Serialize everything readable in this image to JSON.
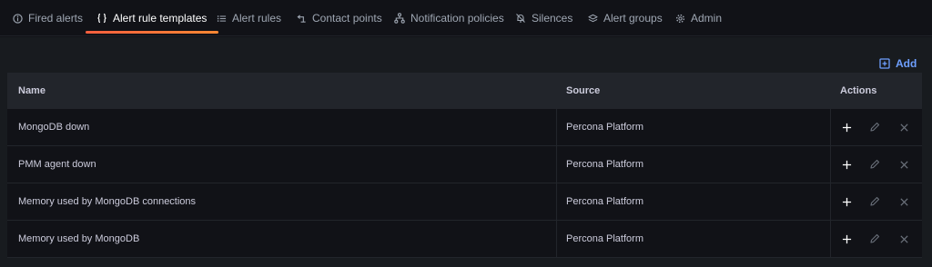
{
  "tabs": [
    {
      "label": "Fired alerts",
      "icon": "info-circle-icon",
      "active": false
    },
    {
      "label": "Alert rule templates",
      "icon": "brackets-icon",
      "active": true
    },
    {
      "label": "Alert rules",
      "icon": "list-icon",
      "active": false
    },
    {
      "label": "Contact points",
      "icon": "contact-arrow-icon",
      "active": false
    },
    {
      "label": "Notification policies",
      "icon": "sitemap-icon",
      "active": false
    },
    {
      "label": "Silences",
      "icon": "bell-slash-icon",
      "active": false
    },
    {
      "label": "Alert groups",
      "icon": "layers-icon",
      "active": false
    },
    {
      "label": "Admin",
      "icon": "gear-icon",
      "active": false
    }
  ],
  "toolbar": {
    "add_label": "Add"
  },
  "table": {
    "headers": {
      "name": "Name",
      "source": "Source",
      "actions": "Actions"
    },
    "rows": [
      {
        "name": "MongoDB down",
        "source": "Percona Platform"
      },
      {
        "name": "PMM agent down",
        "source": "Percona Platform"
      },
      {
        "name": "Memory used by MongoDB connections",
        "source": "Percona Platform"
      },
      {
        "name": "Memory used by MongoDB",
        "source": "Percona Platform"
      }
    ]
  },
  "colors": {
    "accent": "#f55f3e",
    "link": "#6e9fff"
  }
}
